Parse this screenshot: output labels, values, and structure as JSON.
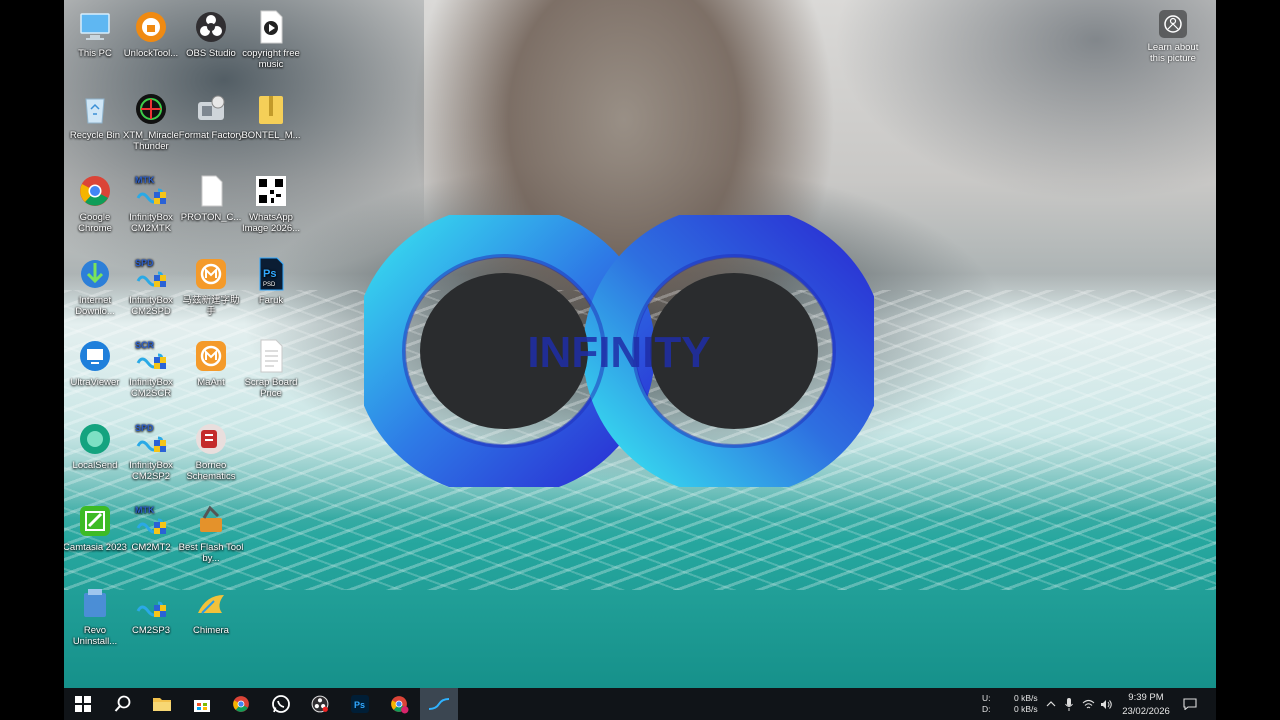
{
  "desktop_icons": [
    {
      "label": "This PC",
      "icon": "computer-icon"
    },
    {
      "label": "Recycle Bin",
      "icon": "recycle-bin-icon"
    },
    {
      "label": "Google Chrome",
      "icon": "chrome-icon"
    },
    {
      "label": "Internet Downlo...",
      "icon": "idm-icon"
    },
    {
      "label": "UltraViewer",
      "icon": "ultraviewer-icon"
    },
    {
      "label": "LocalSend",
      "icon": "localsend-icon"
    },
    {
      "label": "Camtasia 2023",
      "icon": "camtasia-icon"
    },
    {
      "label": "Revo Uninstall...",
      "icon": "revo-icon"
    },
    {
      "label": "UnlockTool...",
      "icon": "unlocktool-icon"
    },
    {
      "label": "XTM_Miracle Thunder",
      "icon": "miracle-thunder-icon"
    },
    {
      "label": "InfinityBox CM2MTK",
      "icon": "infinitybox-icon",
      "badge": "MTK"
    },
    {
      "label": "InfinityBox CM2SPD",
      "icon": "infinitybox-icon",
      "badge": "SPD"
    },
    {
      "label": "InfinityBox CM2SCR",
      "icon": "infinitybox-icon",
      "badge": "SCR"
    },
    {
      "label": "InfinityBox CM2SP2",
      "icon": "infinitybox-icon",
      "badge": "SPD"
    },
    {
      "label": "CM2MT2",
      "icon": "infinitybox-icon",
      "badge": "MTK"
    },
    {
      "label": "CM2SP3",
      "icon": "infinitybox-icon",
      "badge": ""
    },
    {
      "label": "OBS Studio",
      "icon": "obs-icon"
    },
    {
      "label": "Format Factory",
      "icon": "format-factory-icon"
    },
    {
      "label": "PROTON_C...",
      "icon": "file-icon"
    },
    {
      "label": "马兹新建字助手",
      "icon": "maant-icon"
    },
    {
      "label": "MaAnt",
      "icon": "maant-icon"
    },
    {
      "label": "Borneo Schematics",
      "icon": "borneo-icon"
    },
    {
      "label": "Best Flash Tool by...",
      "icon": "flash-tool-icon"
    },
    {
      "label": "Chimera",
      "icon": "chimera-icon"
    },
    {
      "label": "copyright free music",
      "icon": "video-file-icon"
    },
    {
      "label": "BONTEL_M...",
      "icon": "zip-folder-icon"
    },
    {
      "label": "WhatsApp Image 2026...",
      "icon": "qr-image-icon"
    },
    {
      "label": "Faruk",
      "icon": "photoshop-file-icon"
    },
    {
      "label": "Scrap Board Price",
      "icon": "text-file-icon"
    }
  ],
  "learn_about": {
    "label": "Learn about this picture",
    "icon": "camera-icon"
  },
  "wallpaper_logo": {
    "text": "INFINITY"
  },
  "taskbar": {
    "apps": [
      "start-icon",
      "search-icon",
      "file-explorer-icon",
      "store-icon",
      "chrome-icon",
      "whatsapp-icon",
      "obs-icon",
      "photoshop-icon",
      "chrome-profile-icon",
      "camtasia-icon"
    ],
    "active_app": "camtasia-icon",
    "net_labels": {
      "up": "U:",
      "down": "D:"
    },
    "net_values": {
      "up": "0 kB/s",
      "down": "0 kB/s"
    },
    "time": "9:39 PM",
    "date": "23/02/2026"
  },
  "colors": {
    "taskbar_bg": "#101418",
    "infinity_light": "#2fd3ee",
    "infinity_dark": "#2a3fd6"
  }
}
